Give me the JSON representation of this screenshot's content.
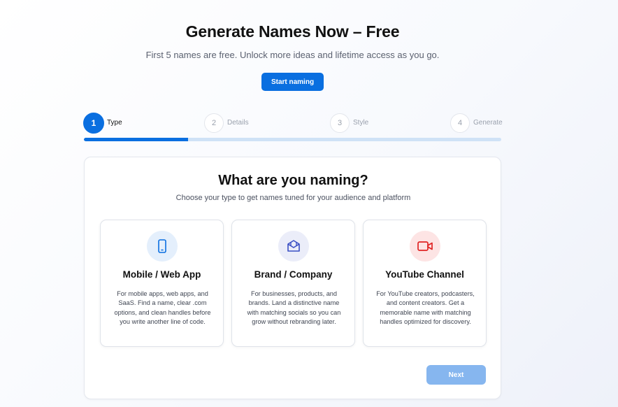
{
  "hero": {
    "title": "Generate Names Now – Free",
    "subtitle": "First 5 names are free. Unlock more ideas and lifetime access as you go.",
    "cta_label": "Start naming"
  },
  "stepper": {
    "progress_fraction": 0.25,
    "steps": [
      {
        "number": "1",
        "label": "Type",
        "active": true
      },
      {
        "number": "2",
        "label": "Details",
        "active": false
      },
      {
        "number": "3",
        "label": "Style",
        "active": false
      },
      {
        "number": "4",
        "label": "Generate",
        "active": false
      }
    ]
  },
  "card": {
    "title": "What are you naming?",
    "subtitle": "Choose your type to get names tuned for your audience and platform",
    "options": [
      {
        "title": "Mobile / Web App",
        "description": "For mobile apps, web apps, and SaaS. Find a name, clear .com options, and clean handles before you write another line of code.",
        "icon": "mobile-phone-icon"
      },
      {
        "title": "Brand / Company",
        "description": "For businesses, products, and brands. Land a distinctive name with matching socials so you can grow without rebranding later.",
        "icon": "brand-mailbox-icon"
      },
      {
        "title": "YouTube Channel",
        "description": "For YouTube creators, podcasters, and content creators. Get a memorable name with matching handles optimized for discovery.",
        "icon": "video-camera-icon"
      }
    ],
    "next_label": "Next"
  },
  "colors": {
    "primary": "#0a6fe0",
    "primary_disabled": "#86b6ef",
    "progress_track": "#cfe2f6",
    "app_icon_bg": "#e4effc",
    "brand_icon_bg": "#ebedf9",
    "youtube_icon_bg": "#fde4e4",
    "youtube_icon": "#e02424"
  }
}
